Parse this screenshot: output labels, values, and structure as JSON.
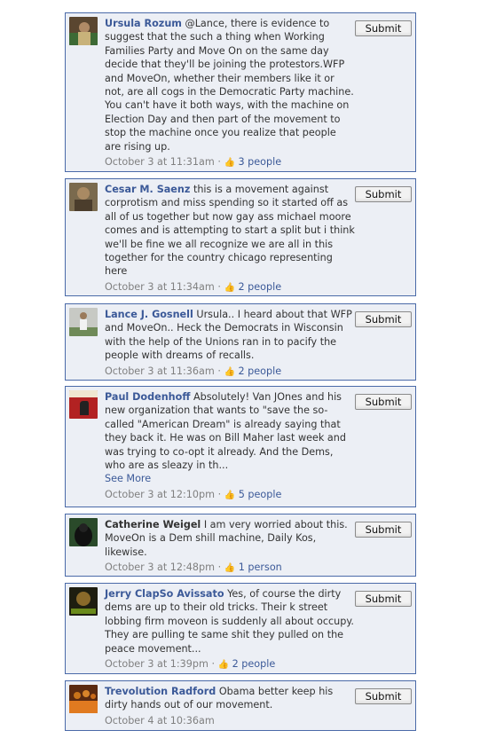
{
  "submit_label": "Submit",
  "comments": [
    {
      "author": "Ursula Rozum",
      "text": "@Lance, there is evidence to suggest that the such a thing when Working Families Party and Move On on the same day decide that they'll be joining the protestors.WFP and MoveOn, whether their members like it or not, are all cogs in the Democratic Party machine. You can't have it both ways, with the machine on Election Day and then part of the movement to stop the machine once you realize that people are rising up.",
      "timestamp": "October 3 at 11:31am",
      "likes": "3 people"
    },
    {
      "author": "Cesar M. Saenz",
      "text": "this is a movement against corprotism and miss spending so it started off as all of us together but now gay ass michael moore comes and is attempting to start a split but i think we'll be fine we all recognize we are all in this together for the country chicago representing here",
      "timestamp": "October 3 at 11:34am",
      "likes": "2 people"
    },
    {
      "author": "Lance J. Gosnell",
      "text": "Ursula.. I heard about that WFP and MoveOn.. Heck the Democrats in Wisconsin with the help of the Unions ran in to pacify the people with dreams of recalls.",
      "timestamp": "October 3 at 11:36am",
      "likes": "2 people"
    },
    {
      "author": "Paul Dodenhoff",
      "text": "Absolutely! Van JOnes and his new organization that wants to \"save the so-called \"American Dream\" is already saying that they back it. He was on Bill Maher last week and was trying to co-opt it already. And the Dems, who are as sleazy in th...",
      "see_more": "See More",
      "timestamp": "October 3 at 12:10pm",
      "likes": "5 people"
    },
    {
      "author": "Catherine Weigel",
      "text": "I am very worried about this. MoveOn is a Dem shill machine, Daily Kos, likewise.",
      "timestamp": "October 3 at 12:48pm",
      "likes": "1 person"
    },
    {
      "author": "Jerry ClapSo Avissato",
      "text": "Yes, of course the dirty dems are up to their old tricks. Their k street lobbing firm moveon is suddenly all about occupy. They are pulling te same shit they pulled on the peace movement...",
      "timestamp": "October 3 at 1:39pm",
      "likes": "2 people"
    },
    {
      "author": "Trevolution Radford",
      "text": "Obama better keep his dirty hands out of our movement.",
      "timestamp": "October 4 at 10:36am"
    }
  ],
  "icons": {
    "like": "thumbs-up-icon"
  },
  "colors": {
    "link": "#3b5998",
    "box_bg": "#eceff5",
    "box_border": "#4a6aa8",
    "meta": "#808080"
  }
}
